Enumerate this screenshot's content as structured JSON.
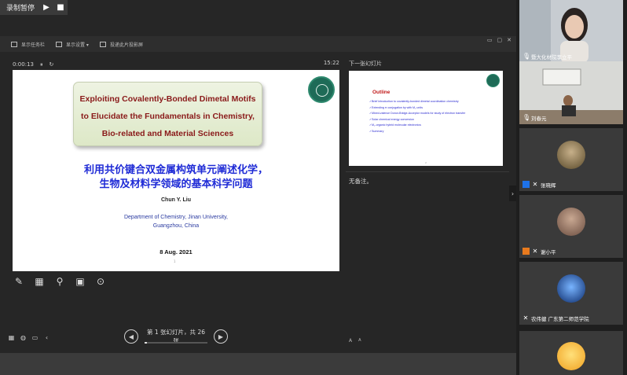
{
  "recording": {
    "label": "录制暂停",
    "play_icon": "play-icon",
    "stop_icon": "stop-icon"
  },
  "toolbar": {
    "items": [
      "显示任务栏",
      "显示设置 ▾",
      "投递此片投影屏"
    ],
    "window_controls": [
      "▭",
      "▢",
      "✕"
    ]
  },
  "presenter": {
    "timer": "0:00:13",
    "pause_symbol": "⏸",
    "reset_symbol": "↻",
    "clock": "15:22",
    "under_slide_text": " "
  },
  "slide": {
    "title_lines": [
      "Exploiting Covalently-Bonded Dimetal Motifs",
      "to Elucidate the Fundamentals in Chemistry,",
      "Bio-related and Material Sciences"
    ],
    "cn_title_lines": [
      "利用共价键合双金属构筑单元阐述化学，",
      "生物及材料学领域的基本科学问题"
    ],
    "author": "Chun Y. Liu",
    "affiliation_lines": [
      "Department of Chemistry, Jinan University,",
      "Guangzhou, China"
    ],
    "date": "8 Aug. 2021",
    "number": "1"
  },
  "next_slide": {
    "label": "下一张幻灯片",
    "outline_title": "Outline",
    "outline_items": [
      "Brief introduction to covalently-bonded dimetal coordination chemistry",
      "Extending π conjugation by with M₂ units",
      "Mixed-valence Donor-Bridge-Acceptor models for study of electron transfer",
      "Solar chemical energy conversion",
      "M₂-organic hybrid molecular electronics",
      "Summary"
    ],
    "number": "2"
  },
  "notes": {
    "text": "无备注。",
    "font_larger": "A",
    "font_smaller": "A"
  },
  "navigation": {
    "prev_symbol": "◀",
    "next_symbol": "▶",
    "status": "第 1 张幻灯片，共 26 张",
    "current": 1,
    "total": 26
  },
  "bottom_left_icons": [
    "grid-icon",
    "subtitle-icon",
    "screen-icon",
    "collapse-left-icon"
  ],
  "collapse_symbol": "›",
  "participants": [
    {
      "name": "暨大化材院李立平",
      "kind": "video-woman",
      "badge": ""
    },
    {
      "name": "刘春元",
      "kind": "video-man",
      "badge": ""
    },
    {
      "name": "张晓辉",
      "kind": "avatar",
      "badge": "blue"
    },
    {
      "name": "谢小平",
      "kind": "avatar",
      "badge": "orange"
    },
    {
      "name": "农伟健  广东第二师范学院",
      "kind": "avatar",
      "badge": ""
    },
    {
      "name": "",
      "kind": "avatar",
      "badge": ""
    }
  ],
  "colors": {
    "slide_title": "#8a1a1a",
    "cn_title": "#1f2bd6",
    "outline_title": "#c01818",
    "outline_items": "#2a2ad0",
    "seal": "#1e6b57"
  }
}
